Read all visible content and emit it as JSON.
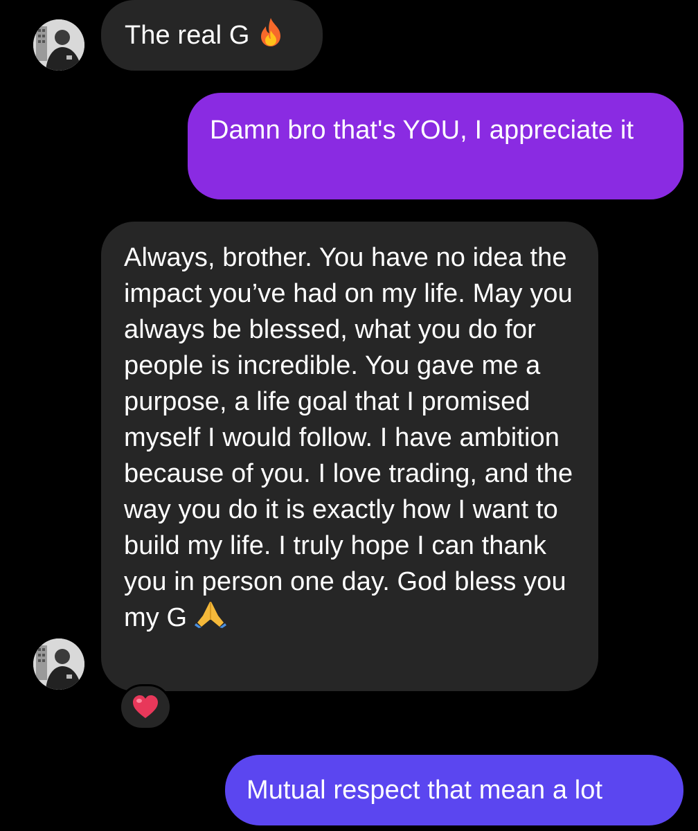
{
  "conversation": {
    "messages": [
      {
        "direction": "incoming",
        "text": "The real G",
        "emoji": "fire-emoji"
      },
      {
        "direction": "outgoing",
        "text": "Damn bro that's YOU, I appreciate it"
      },
      {
        "direction": "incoming",
        "text": "Always, brother. You have no idea the impact you’ve had on my life. May you always be blessed, what you do for people is incredible. You gave me a purpose, a life goal that I promised myself I would follow. I have ambition because of you. I love trading, and the way you do it is exactly how I want to build my life. I truly hope I can thank you in person one day. God bless you my G",
        "emoji": "folded-hands-emoji",
        "reaction": "heart-emoji"
      },
      {
        "direction": "outgoing",
        "text": "Mutual respect that mean a lot"
      }
    ]
  },
  "colors": {
    "background": "#000000",
    "incoming_bubble": "#262626",
    "outgoing_bubble_purple": "#8a2be2",
    "outgoing_bubble_indigo": "#5b46f0",
    "text": "#ffffff",
    "reaction_heart": "#e8385a"
  }
}
